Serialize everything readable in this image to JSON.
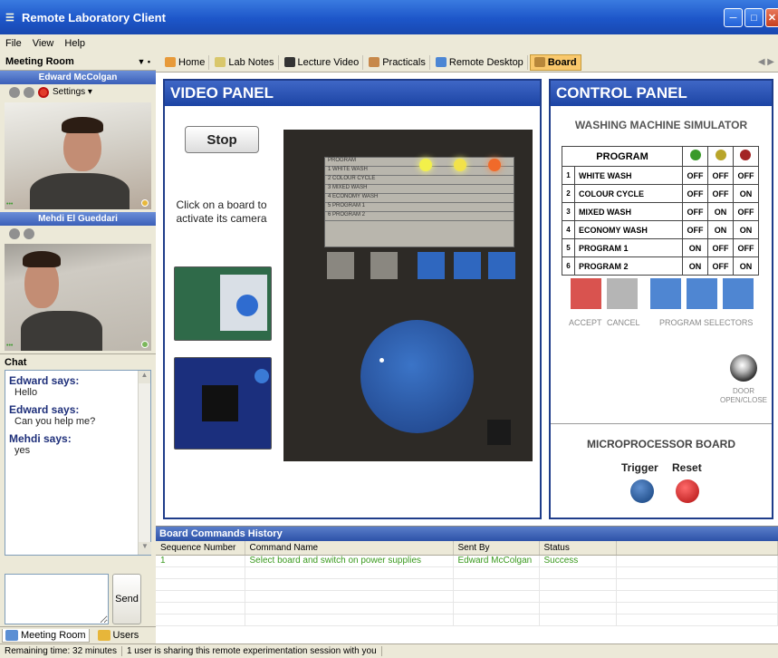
{
  "window": {
    "title": "Remote Laboratory Client"
  },
  "menu": [
    "File",
    "View",
    "Help"
  ],
  "sidebar": {
    "room_selector": "Meeting Room",
    "users": [
      {
        "name": "Edward McColgan",
        "settings_label": "Settings"
      },
      {
        "name": "Mehdi El Gueddari"
      }
    ],
    "chat": {
      "title": "Chat",
      "messages": [
        {
          "who": "Edward says:",
          "text": "Hello"
        },
        {
          "who": "Edward says:",
          "text": "Can you help me?"
        },
        {
          "who": "Mehdi says:",
          "text": "yes"
        }
      ],
      "send_label": "Send"
    },
    "bottom_tabs": [
      "Meeting Room",
      "Users"
    ]
  },
  "tabs": [
    "Home",
    "Lab Notes",
    "Lecture Video",
    "Practicals",
    "Remote Desktop",
    "Board"
  ],
  "video_panel": {
    "title": "VIDEO PANEL",
    "stop_label": "Stop",
    "hint": "Click on a board to activate its camera"
  },
  "control_panel": {
    "title": "CONTROL PANEL",
    "simulator_title": "WASHING MACHINE SIMULATOR",
    "program_header": "PROGRAM",
    "led_colors": [
      "#3a9a2a",
      "#b9a52a",
      "#a32424"
    ],
    "programs": [
      {
        "no": "1",
        "name": "WHITE WASH",
        "states": [
          "OFF",
          "OFF",
          "OFF"
        ]
      },
      {
        "no": "2",
        "name": "COLOUR CYCLE",
        "states": [
          "OFF",
          "OFF",
          "ON"
        ]
      },
      {
        "no": "3",
        "name": "MIXED WASH",
        "states": [
          "OFF",
          "ON",
          "OFF"
        ]
      },
      {
        "no": "4",
        "name": "ECONOMY WASH",
        "states": [
          "OFF",
          "ON",
          "ON"
        ]
      },
      {
        "no": "5",
        "name": "PROGRAM 1",
        "states": [
          "ON",
          "OFF",
          "OFF"
        ]
      },
      {
        "no": "6",
        "name": "PROGRAM 2",
        "states": [
          "ON",
          "OFF",
          "ON"
        ]
      }
    ],
    "accept_label": "ACCEPT",
    "cancel_label": "CANCEL",
    "selectors_label": "PROGRAM SELECTORS",
    "door_label": "DOOR OPEN/CLOSE",
    "micro_title": "MICROPROCESSOR BOARD",
    "trigger_label": "Trigger",
    "reset_label": "Reset"
  },
  "history": {
    "title": "Board Commands History",
    "columns": [
      "Sequence Number",
      "Command Name",
      "Sent By",
      "Status"
    ],
    "rows": [
      {
        "seq": "1",
        "command": "Select board and switch on power supplies",
        "sent_by": "Edward McColgan",
        "status": "Success"
      }
    ]
  },
  "status_bar": {
    "remaining": "Remaining time: 32 minutes",
    "sharing": "1 user is sharing this remote experimentation session with you"
  }
}
